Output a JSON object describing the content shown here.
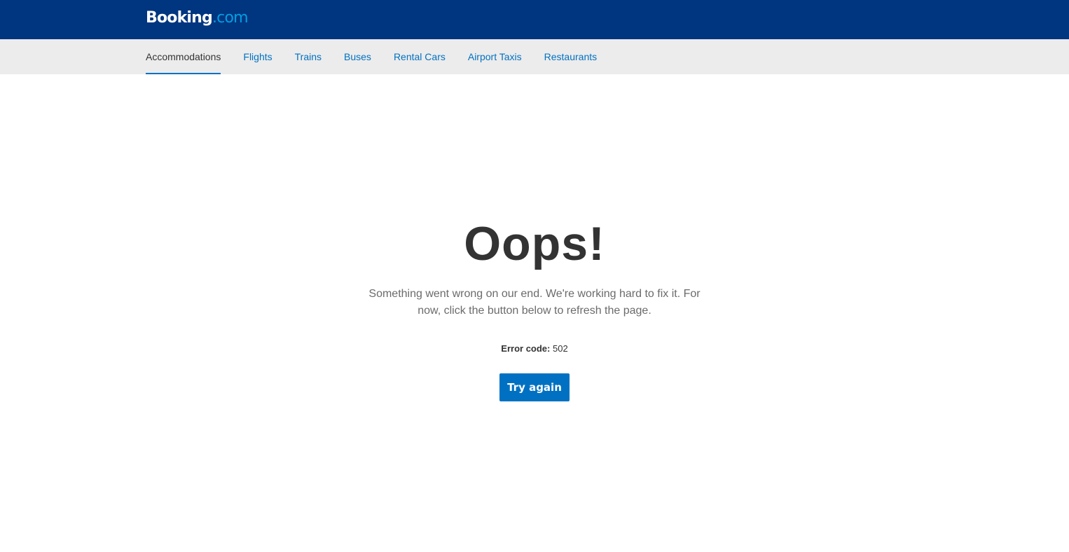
{
  "header": {
    "logo_brand": "Booking",
    "logo_tld": ".com"
  },
  "nav": {
    "items": [
      {
        "label": "Accommodations",
        "active": true
      },
      {
        "label": "Flights",
        "active": false
      },
      {
        "label": "Trains",
        "active": false
      },
      {
        "label": "Buses",
        "active": false
      },
      {
        "label": "Rental Cars",
        "active": false
      },
      {
        "label": "Airport Taxis",
        "active": false
      },
      {
        "label": "Restaurants",
        "active": false
      }
    ]
  },
  "error": {
    "title": "Oops!",
    "message": "Something went wrong on our end. We're working hard to fix it. For now, click the button below to refresh the page.",
    "code_label": "Error code:",
    "code_value": "502",
    "button_label": "Try again"
  },
  "colors": {
    "header_bg": "#003580",
    "nav_bg": "#ececec",
    "link": "#0071c2",
    "button_bg": "#0071c2",
    "text_dark": "#333333"
  }
}
